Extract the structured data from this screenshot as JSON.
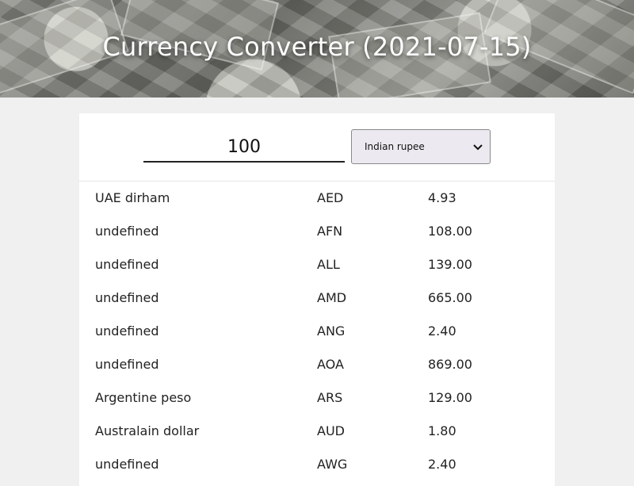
{
  "header": {
    "title": "Currency Converter (2021-07-15)"
  },
  "converter": {
    "amount": "100",
    "selected_currency": "Indian rupee"
  },
  "rates": [
    {
      "name": "UAE dirham",
      "code": "AED",
      "value": "4.93"
    },
    {
      "name": "undefined",
      "code": "AFN",
      "value": "108.00"
    },
    {
      "name": "undefined",
      "code": "ALL",
      "value": "139.00"
    },
    {
      "name": "undefined",
      "code": "AMD",
      "value": "665.00"
    },
    {
      "name": "undefined",
      "code": "ANG",
      "value": "2.40"
    },
    {
      "name": "undefined",
      "code": "AOA",
      "value": "869.00"
    },
    {
      "name": "Argentine peso",
      "code": "ARS",
      "value": "129.00"
    },
    {
      "name": "Australain dollar",
      "code": "AUD",
      "value": "1.80"
    },
    {
      "name": "undefined",
      "code": "AWG",
      "value": "2.40"
    }
  ]
}
